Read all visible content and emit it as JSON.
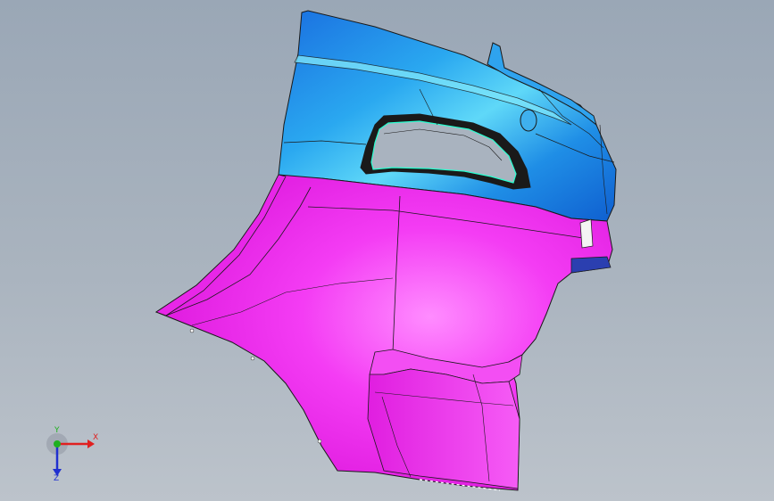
{
  "viewport": {
    "name": "3D model view",
    "part_colors": {
      "upper_surface": "#1e8ee8",
      "lower_surface": "#f01ff0",
      "edge_lines": "#1a1a1a",
      "background_top": "#9aa7b6",
      "background_bottom": "#bcc3cb"
    }
  },
  "triad": {
    "x_label": "X",
    "y_label": "Y",
    "z_label": "Z",
    "x_color": "#e02020",
    "y_color": "#20b020",
    "z_color": "#2030d0"
  }
}
